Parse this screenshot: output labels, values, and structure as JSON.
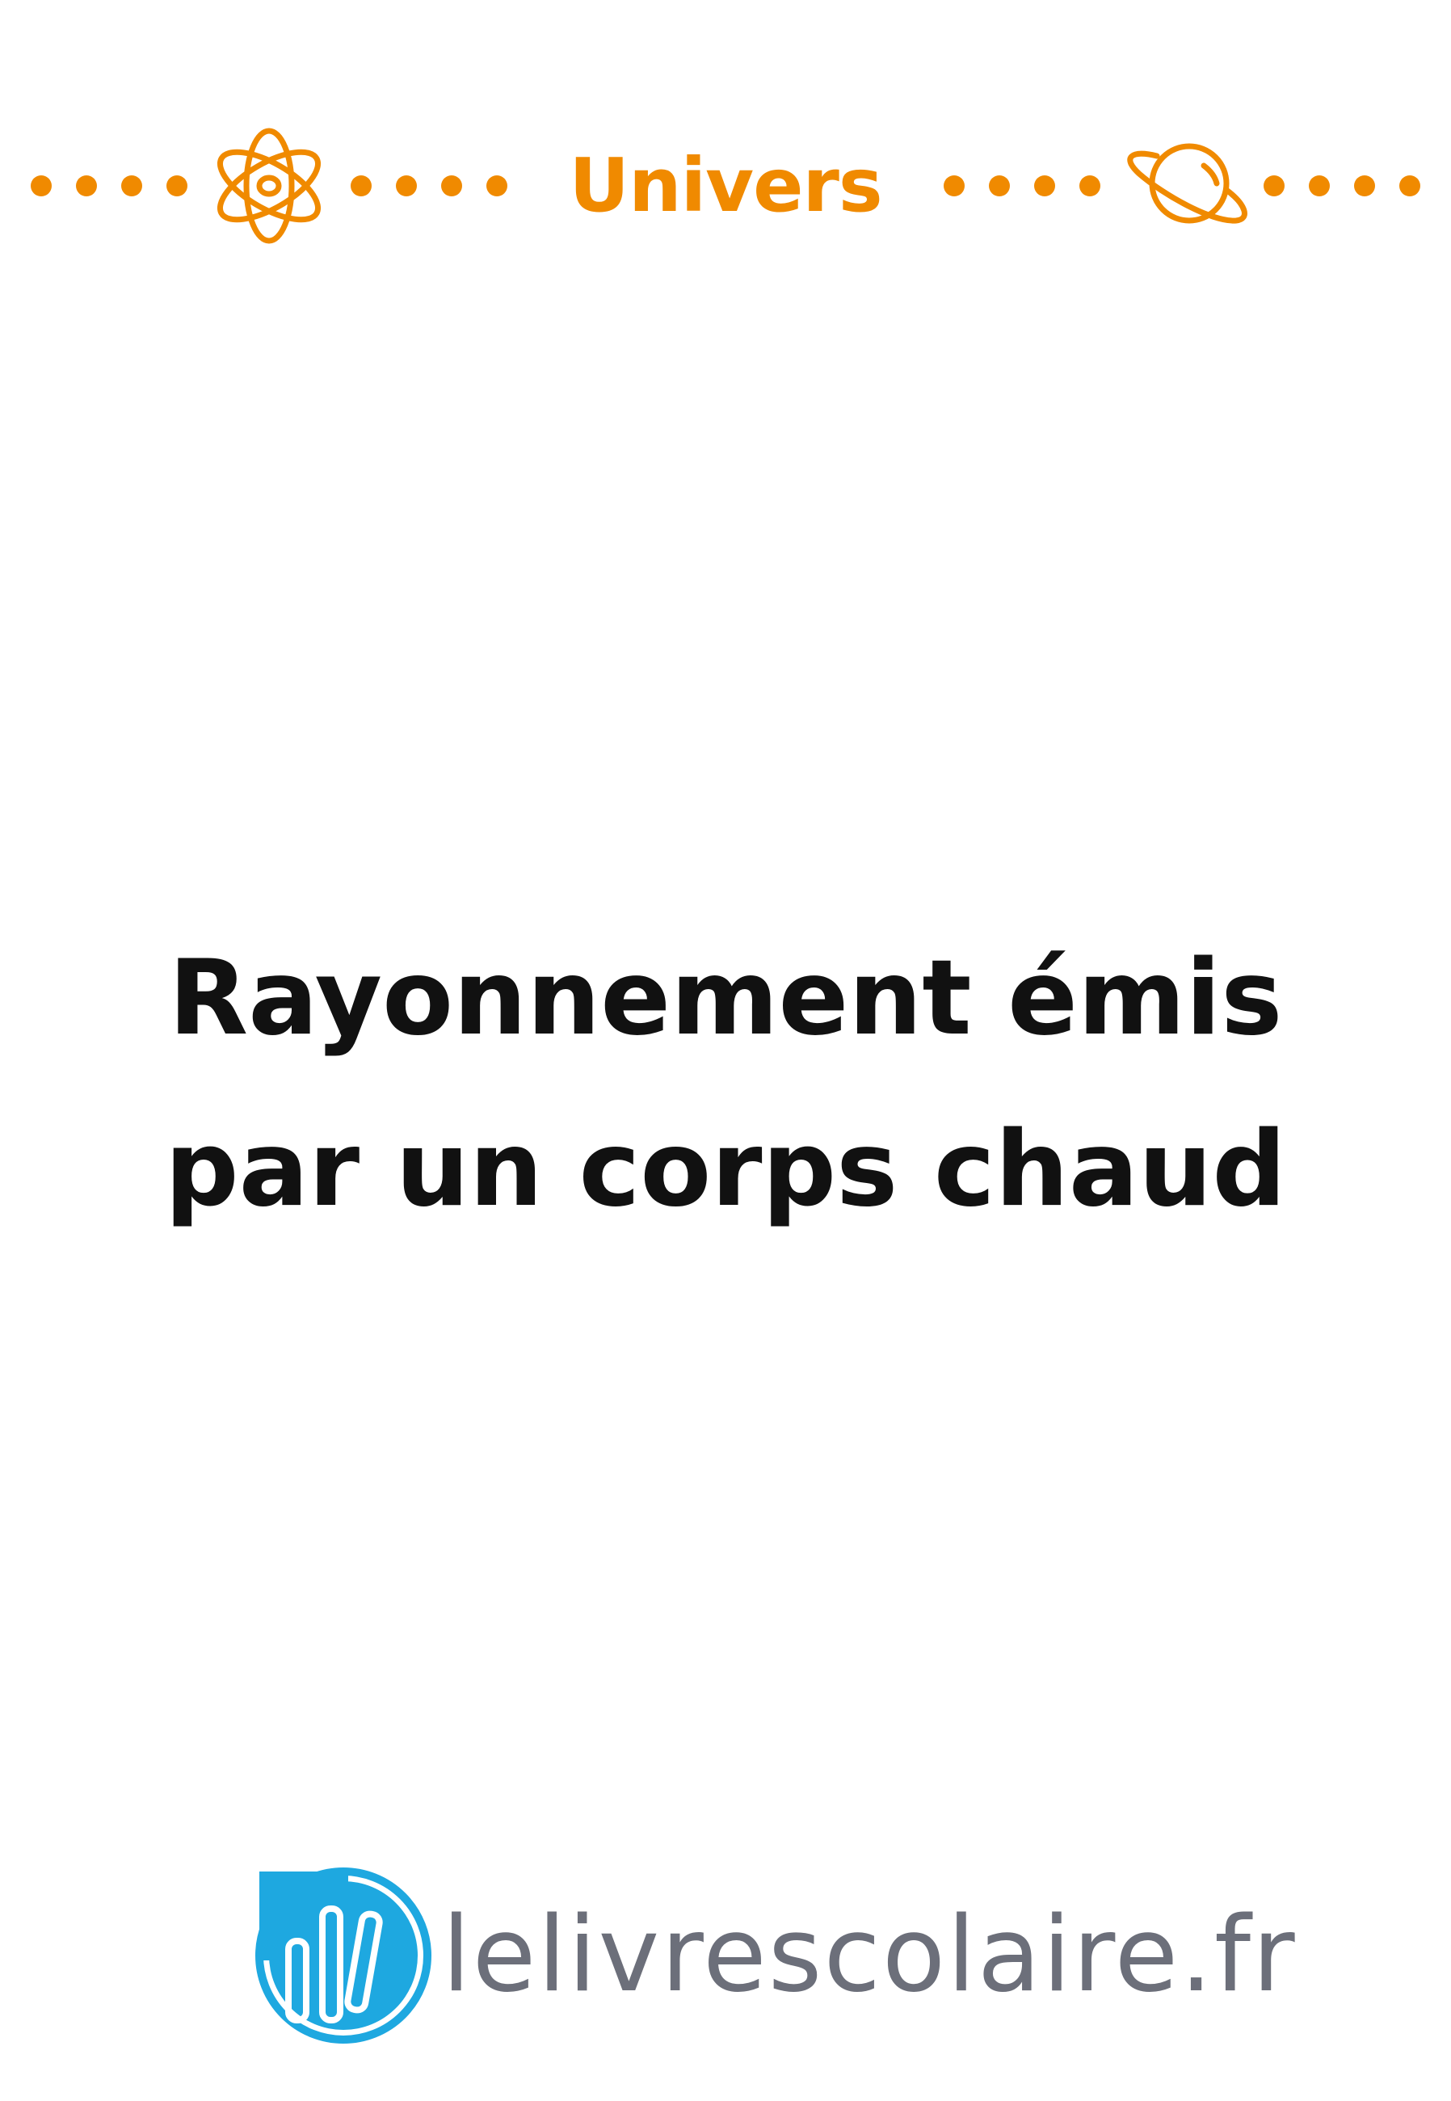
{
  "header": {
    "section_label": "Univers",
    "accent_color": "#f08a00",
    "left_icon": "atom-icon",
    "right_icon": "planet-icon"
  },
  "document": {
    "title_line1": "Rayonnement émis",
    "title_line2": "par un corps chaud"
  },
  "footer": {
    "brand": "lelivrescolaire.fr",
    "brand_color": "#6c6f7a",
    "logo_color": "#1ea8e0",
    "logo_icon": "books-logo-icon"
  }
}
